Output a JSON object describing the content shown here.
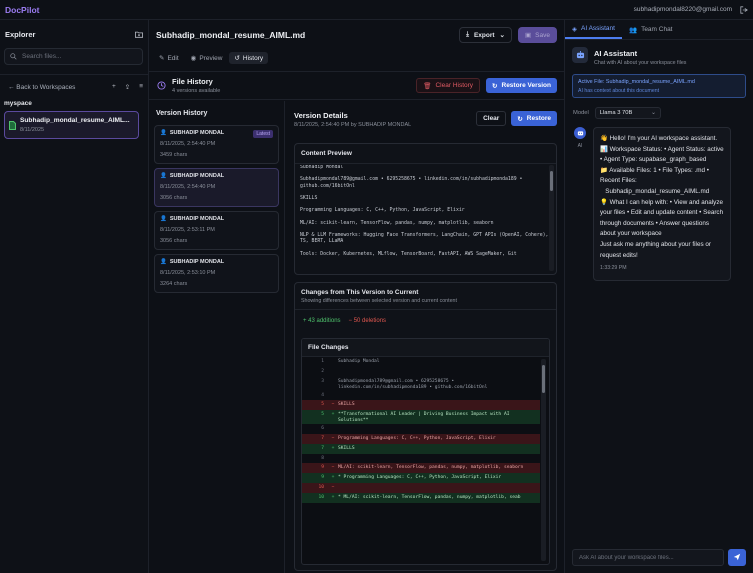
{
  "app": {
    "name": "DocPilot",
    "user_email": "subhadipmondal8220@gmail.com"
  },
  "explorer": {
    "title": "Explorer",
    "search_placeholder": "Search files...",
    "back_label": "← Back to Workspaces",
    "workspace": "myspace",
    "file": {
      "name": "Subhadip_mondal_resume_AIML...",
      "date": "8/11/2025"
    }
  },
  "editor": {
    "filename": "Subhadip_mondal_resume_AIML.md",
    "export_label": "Export",
    "save_label": "Save",
    "tabs": [
      {
        "label": "Edit"
      },
      {
        "label": "Preview"
      },
      {
        "label": "History"
      }
    ]
  },
  "history": {
    "title": "File History",
    "subtitle": "4 versions available",
    "clear_label": "Clear History",
    "restore_label": "Restore Version",
    "list_title": "Version History",
    "latest_badge": "Latest",
    "versions": [
      {
        "author": "SUBHADIP MONDAL",
        "date": "8/11/2025, 2:54:40 PM",
        "chars": "3459 chars"
      },
      {
        "author": "SUBHADIP MONDAL",
        "date": "8/11/2025, 2:54:40 PM",
        "chars": "3056 chars"
      },
      {
        "author": "SUBHADIP MONDAL",
        "date": "8/11/2025, 2:53:11 PM",
        "chars": "3056 chars"
      },
      {
        "author": "SUBHADIP MONDAL",
        "date": "8/11/2025, 2:53:10 PM",
        "chars": "3264 chars"
      }
    ]
  },
  "details": {
    "title": "Version Details",
    "subtitle": "8/11/2025, 2:54:40 PM by SUBHADIP MONDAL",
    "clear_label": "Clear",
    "restore_label": "Restore",
    "preview_title": "Content Preview",
    "preview_text": "Subhadip Mondal\n\nSubhadipmondal789@gmail.com • 6295258675 • linkedin.com/in/subhadipmonda189 • github.com/16bitOnl\n\nSKILLS\n\nProgramming Languages: C, C++, Python, JavaScript, Elixir\n\nML/AI: scikit-learn, TensorFlow, pandas, numpy, matplotlib, seaborn\n\nNLP & LLM Frameworks: Hugging Face Transformers, LangChain, GPT APIs (OpenAI, Cohere), TS, BERT, LLaMA\n\nTools: Docker, Kubernetes, MLflow, TensorBoard, FastAPI, AWS SageMaker, Git",
    "changes_title": "Changes from This Version to Current",
    "changes_subtitle": "Showing differences between selected version and current content",
    "additions": "+ 43 additions",
    "deletions": "− 50 deletions",
    "file_changes_title": "File Changes",
    "diff": [
      {
        "n": "1",
        "s": "",
        "t": "Subhadip Mondal",
        "k": "ctx"
      },
      {
        "n": "2",
        "s": "",
        "t": "",
        "k": "ctx"
      },
      {
        "n": "3",
        "s": "",
        "t": "Subhadipmondal789@gmail.com • 6295258675 • linkedin.com/in/subhadipmonda189 • github.com/16bitOnl",
        "k": "ctx"
      },
      {
        "n": "4",
        "s": "",
        "t": "",
        "k": "ctx"
      },
      {
        "n": "5",
        "s": "−",
        "t": "SKILLS",
        "k": "r"
      },
      {
        "n": "5",
        "s": "+",
        "t": "**Transformational AI Leader | Driving Business Impact with AI Solutions**",
        "k": "a"
      },
      {
        "n": "6",
        "s": "",
        "t": "",
        "k": "ctx"
      },
      {
        "n": "7",
        "s": "−",
        "t": "Programming Languages: C, C++, Python, JavaScript, Elixir",
        "k": "r"
      },
      {
        "n": "7",
        "s": "+",
        "t": "SKILLS",
        "k": "a"
      },
      {
        "n": "8",
        "s": "",
        "t": "",
        "k": "ctx"
      },
      {
        "n": "9",
        "s": "−",
        "t": "ML/AI: scikit-learn, TensorFlow, pandas, numpy, matplotlib, seaborn",
        "k": "r"
      },
      {
        "n": "9",
        "s": "+",
        "t": "* Programming Languages: C, C++, Python, JavaScript, Elixir",
        "k": "a"
      },
      {
        "n": "10",
        "s": "−",
        "t": "",
        "k": "r"
      },
      {
        "n": "10",
        "s": "+",
        "t": "* ML/AI: scikit-learn, TensorFlow, pandas, numpy, matplotlib, seab",
        "k": "a"
      }
    ]
  },
  "assistant": {
    "tabs": [
      {
        "label": "AI Assistant"
      },
      {
        "label": "Team Chat"
      }
    ],
    "title": "AI Assistant",
    "subtitle": "Chat with AI about your workspace files",
    "active_file": "Active File: Subhadip_mondal_resume_AIML.md",
    "active_note": "AI has context about this document",
    "model_label": "Model",
    "model_value": "Llama 3 70B",
    "bot_label": "AI",
    "message": [
      "👋 Hello! I'm your AI workspace assistant.",
      "📊 Workspace Status: • Agent Status: active • Agent Type: supabase_graph_based",
      "📁 Available Files: 1 • File Types: .md • Recent Files:",
      "   Subhadip_mondal_resume_AIML.md",
      "💡 What I can help with: • View and analyze your files • Edit and update content • Search through documents • Answer questions about your workspace",
      "Just ask me anything about your files or request edits!"
    ],
    "time": "1:33:29 PM",
    "input_placeholder": "Ask AI about your workspace files..."
  },
  "colors": {
    "accent": "#9b7cf2",
    "primary": "#3a63d6",
    "danger": "#e0574f",
    "success": "#4fc26c"
  }
}
